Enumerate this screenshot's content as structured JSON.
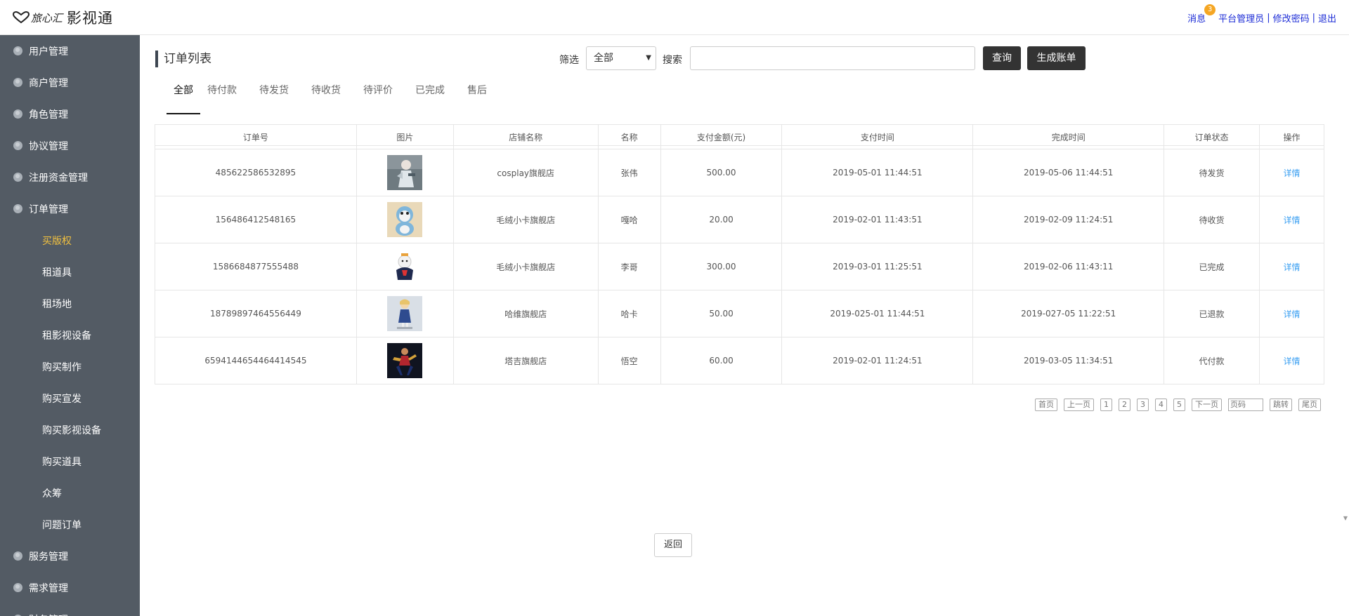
{
  "header": {
    "logo_script": "旅心汇",
    "app_name": "影视通",
    "links": {
      "messages": "消息",
      "message_count": "3",
      "admin": "平台管理员",
      "change_password": "修改密码",
      "logout": "退出",
      "separator": "|"
    }
  },
  "sidebar": {
    "items": [
      {
        "label": "用户管理",
        "level": "top"
      },
      {
        "label": "商户管理",
        "level": "top"
      },
      {
        "label": "角色管理",
        "level": "top"
      },
      {
        "label": "协议管理",
        "level": "top"
      },
      {
        "label": "注册资金管理",
        "level": "top"
      },
      {
        "label": "订单管理",
        "level": "top"
      },
      {
        "label": "买版权",
        "level": "sub",
        "active": true
      },
      {
        "label": "租道具",
        "level": "sub"
      },
      {
        "label": "租场地",
        "level": "sub"
      },
      {
        "label": "租影视设备",
        "level": "sub"
      },
      {
        "label": "购买制作",
        "level": "sub"
      },
      {
        "label": "购买宣发",
        "level": "sub"
      },
      {
        "label": "购买影视设备",
        "level": "sub"
      },
      {
        "label": "购买道具",
        "level": "sub"
      },
      {
        "label": "众筹",
        "level": "sub"
      },
      {
        "label": "问题订单",
        "level": "sub"
      },
      {
        "label": "服务管理",
        "level": "top"
      },
      {
        "label": "需求管理",
        "level": "top"
      },
      {
        "label": "财务管理",
        "level": "top"
      }
    ]
  },
  "main": {
    "title": "订单列表",
    "filter_label": "筛选",
    "filter_value": "全部",
    "search_label": "搜索",
    "search_value": "",
    "query_button": "查询",
    "bill_button": "生成账单",
    "tabs": [
      "全部",
      "待付款",
      "待发货",
      "待收货",
      "待评价",
      "已完成",
      "售后"
    ],
    "active_tab": "全部",
    "table": {
      "headers": [
        "订单号",
        "图片",
        "店铺名称",
        "名称",
        "支付金额(元)",
        "支付时间",
        "完成时间",
        "订单状态",
        "操作"
      ],
      "rows": [
        {
          "order_no": "485622586532895",
          "image": "cosplay-figure-thumbnail",
          "shop": "cosplay旗舰店",
          "name": "张伟",
          "amount": "500.00",
          "pay_time": "2019-05-01 11:44:51",
          "done_time": "2019-05-06 11:44:51",
          "status": "待发货",
          "action": "详情"
        },
        {
          "order_no": "156486412548165",
          "image": "plush-doll-thumbnail",
          "shop": "毛绒小卡旗舰店",
          "name": "嘎哈",
          "amount": "20.00",
          "pay_time": "2019-02-01 11:43:51",
          "done_time": "2019-02-09 11:24:51",
          "status": "待收货",
          "action": "详情"
        },
        {
          "order_no": "1586684877555488",
          "image": "penguin-toy-thumbnail",
          "shop": "毛绒小卡旗舰店",
          "name": "李哥",
          "amount": "300.00",
          "pay_time": "2019-03-01 11:25:51",
          "done_time": "2019-02-06 11:43:11",
          "status": "已完成",
          "action": "详情"
        },
        {
          "order_no": "18789897464556449",
          "image": "anime-figure-thumbnail",
          "shop": "哈维旗舰店",
          "name": "哈卡",
          "amount": "50.00",
          "pay_time": "2019-025-01 11:44:51",
          "done_time": "2019-027-05 11:22:51",
          "status": "已退款",
          "action": "详情"
        },
        {
          "order_no": "6594144654464414545",
          "image": "hero-figure-thumbnail",
          "shop": "塔吉旗舰店",
          "name": "悟空",
          "amount": "60.00",
          "pay_time": "2019-02-01 11:24:51",
          "done_time": "2019-03-05 11:34:51",
          "status": "代付款",
          "action": "详情"
        }
      ]
    },
    "pager": {
      "first": "首页",
      "prev": "上一页",
      "pages": [
        "1",
        "2",
        "3",
        "4",
        "5"
      ],
      "next": "下一页",
      "page_input_placeholder": "页码",
      "jump": "跳转",
      "last": "尾页"
    },
    "back_button": "返回"
  }
}
